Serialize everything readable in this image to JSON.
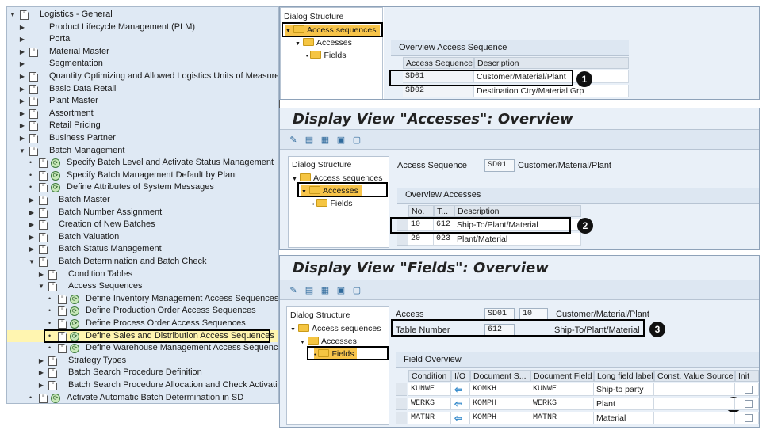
{
  "tree": {
    "items": [
      {
        "label": "Logistics - General",
        "exp": "open",
        "dot": false,
        "icon": true,
        "clock": false
      },
      {
        "label": "Product Lifecycle Management (PLM)",
        "exp": "closed",
        "dot": false,
        "icon": false,
        "clock": false
      },
      {
        "label": "Portal",
        "exp": "closed",
        "dot": false,
        "icon": false,
        "clock": false
      },
      {
        "label": "Material Master",
        "exp": "closed",
        "dot": false,
        "icon": true,
        "clock": false
      },
      {
        "label": "Segmentation",
        "exp": "closed",
        "dot": false,
        "icon": false,
        "clock": false
      },
      {
        "label": "Quantity Optimizing and Allowed Logistics Units of Measure",
        "exp": "closed",
        "dot": false,
        "icon": true,
        "clock": false
      },
      {
        "label": "Basic Data Retail",
        "exp": "closed",
        "dot": false,
        "icon": true,
        "clock": false
      },
      {
        "label": "Plant Master",
        "exp": "closed",
        "dot": false,
        "icon": true,
        "clock": false
      },
      {
        "label": "Assortment",
        "exp": "closed",
        "dot": false,
        "icon": true,
        "clock": false
      },
      {
        "label": "Retail Pricing",
        "exp": "closed",
        "dot": false,
        "icon": true,
        "clock": false
      },
      {
        "label": "Business Partner",
        "exp": "closed",
        "dot": false,
        "icon": true,
        "clock": false
      },
      {
        "label": "Batch Management",
        "exp": "open",
        "dot": false,
        "icon": true,
        "clock": false
      },
      {
        "label": "Specify Batch Level and Activate Status Management",
        "exp": "none",
        "dot": true,
        "icon": true,
        "clock": true
      },
      {
        "label": "Specify Batch Management Default by Plant",
        "exp": "none",
        "dot": true,
        "icon": true,
        "clock": true
      },
      {
        "label": "Define Attributes of System Messages",
        "exp": "none",
        "dot": true,
        "icon": true,
        "clock": true
      },
      {
        "label": "Batch Master",
        "exp": "closed",
        "dot": false,
        "icon": true,
        "clock": false
      },
      {
        "label": "Batch Number Assignment",
        "exp": "closed",
        "dot": false,
        "icon": true,
        "clock": false
      },
      {
        "label": "Creation of New Batches",
        "exp": "closed",
        "dot": false,
        "icon": true,
        "clock": false
      },
      {
        "label": "Batch Valuation",
        "exp": "closed",
        "dot": false,
        "icon": true,
        "clock": false
      },
      {
        "label": "Batch Status Management",
        "exp": "closed",
        "dot": false,
        "icon": true,
        "clock": false
      },
      {
        "label": "Batch Determination and Batch Check",
        "exp": "open",
        "dot": false,
        "icon": true,
        "clock": false
      },
      {
        "label": "Condition Tables",
        "exp": "closed",
        "dot": false,
        "icon": true,
        "clock": false
      },
      {
        "label": "Access Sequences",
        "exp": "open",
        "dot": false,
        "icon": true,
        "clock": false
      },
      {
        "label": "Define Inventory Management Access Sequences",
        "exp": "none",
        "dot": true,
        "icon": true,
        "clock": true
      },
      {
        "label": "Define Production Order Access Sequences",
        "exp": "none",
        "dot": true,
        "icon": true,
        "clock": true
      },
      {
        "label": "Define Process Order Access Sequences",
        "exp": "none",
        "dot": true,
        "icon": true,
        "clock": true
      },
      {
        "label": "Define Sales and Distribution Access Sequences",
        "exp": "none",
        "dot": true,
        "icon": true,
        "clock": true
      },
      {
        "label": "Define Warehouse Management Access Sequences",
        "exp": "none",
        "dot": true,
        "icon": true,
        "clock": true
      },
      {
        "label": "Strategy Types",
        "exp": "closed",
        "dot": false,
        "icon": true,
        "clock": false
      },
      {
        "label": "Batch Search Procedure Definition",
        "exp": "closed",
        "dot": false,
        "icon": true,
        "clock": false
      },
      {
        "label": "Batch Search Procedure Allocation and Check Activation",
        "exp": "closed",
        "dot": false,
        "icon": true,
        "clock": false
      },
      {
        "label": "Activate Automatic Batch Determination in SD",
        "exp": "none",
        "dot": true,
        "icon": true,
        "clock": true
      }
    ]
  },
  "p1": {
    "dialog_structure": "Dialog Structure",
    "ds_items": [
      "Access sequences",
      "Accesses",
      "Fields"
    ],
    "section_title": "Overview Access Sequence",
    "headers": [
      "Access Sequence",
      "Description"
    ],
    "rows": [
      [
        "SD01",
        "Customer/Material/Plant"
      ],
      [
        "SD02",
        "Destination Ctry/Material Grp"
      ]
    ]
  },
  "p2": {
    "title": "Display View \"Accesses\": Overview",
    "dialog_structure": "Dialog Structure",
    "ds_items": [
      "Access sequences",
      "Accesses",
      "Fields"
    ],
    "access_seq_label": "Access Sequence",
    "access_seq_value": "SD01",
    "access_seq_desc": "Customer/Material/Plant",
    "section_title": "Overview Accesses",
    "headers": [
      "No.",
      "T...",
      "Description"
    ],
    "rows": [
      [
        "10",
        "612",
        "Ship-To/Plant/Material"
      ],
      [
        "20",
        "023",
        "Plant/Material"
      ]
    ]
  },
  "p3": {
    "title": "Display View \"Fields\": Overview",
    "dialog_structure": "Dialog Structure",
    "ds_items": [
      "Access sequences",
      "Accesses",
      "Fields"
    ],
    "access_label": "Access",
    "access_value": "SD01",
    "access_no": "10",
    "access_desc": "Customer/Material/Plant",
    "table_label": "Table Number",
    "table_value": "612",
    "table_desc": "Ship-To/Plant/Material",
    "section_title": "Field Overview",
    "headers": [
      "Condition",
      "I/O",
      "Document S...",
      "Document Field",
      "Long field label",
      "Const. Value Source",
      "Init"
    ],
    "rows": [
      [
        "KUNWE",
        "KOMKH",
        "KUNWE",
        "Ship-to party"
      ],
      [
        "WERKS",
        "KOMPH",
        "WERKS",
        "Plant"
      ],
      [
        "MATNR",
        "KOMPH",
        "MATNR",
        "Material"
      ]
    ]
  },
  "badges": [
    "1",
    "2",
    "3",
    "4"
  ]
}
